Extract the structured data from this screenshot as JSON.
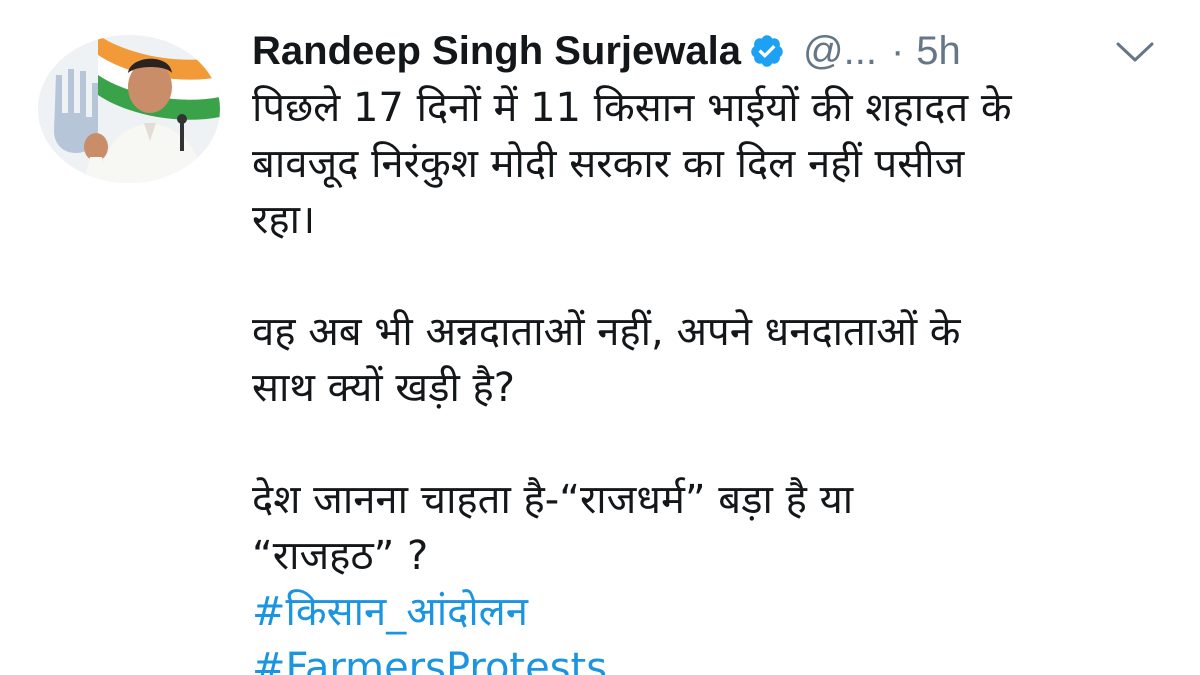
{
  "tweet": {
    "author": {
      "display_name": "Randeep Singh Surjewala",
      "verified_icon": "verified-badge-icon",
      "handle": "@...",
      "separator": "·",
      "time": "5h",
      "avatar_icon": "profile-photo"
    },
    "menu_icon": "chevron-down-icon",
    "paragraphs": [
      "पिछले 17 दिनों में 11 किसान भाईयों की शहादत के\nबावजूद निरंकुश मोदी सरकार का दिल नहीं पसीज\nरहा।",
      "वह अब भी अन्नदाताओं नहीं, अपने धनदाताओं के\nसाथ क्यों खड़ी है?",
      "देश जानना चाहता है-“राजधर्म” बड़ा है या\n“राजहठ” ?"
    ],
    "hashtags": [
      "#किसान_आंदोलन",
      "#FarmersProtests"
    ]
  },
  "colors": {
    "text": "#14171a",
    "muted": "#657786",
    "link": "#1b95e0",
    "verified": "#1da1f2"
  }
}
